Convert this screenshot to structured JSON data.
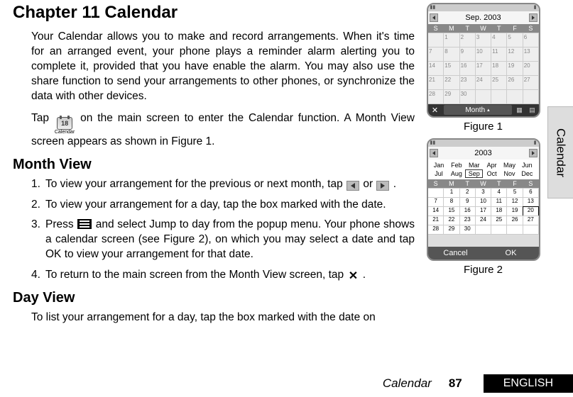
{
  "chapter_title": "Chapter 11 Calendar",
  "intro_p1": "Your Calendar allows you to make and record arrangements. When it's time for an arranged event, your phone plays a reminder alarm alerting you to complete it, provided that you have enable the alarm. You may also use the share function to send your arrangements to other phones, or synchronize the data with other devices.",
  "intro_p2_a": "Tap",
  "intro_p2_b": "on the main screen to enter the Calendar function. A Month View screen appears as shown in Figure 1.",
  "cal_icon_label": "Calendar",
  "cal_icon_num": "18",
  "section_month": "Month View",
  "month_items": {
    "i1_a": "To view your arrangement for the previous or next month, tap",
    "i1_b": "or",
    "i1_c": ".",
    "i2": "To view your arrangement for a day, tap the box marked with the date.",
    "i3_a": "Press",
    "i3_b": "and select Jump to day from the popup menu. Your phone shows a calendar screen (see Figure 2), on which you may select a date and tap OK to view your arrangement for that date.",
    "i4_a": "To return to the main screen from the Month View screen, tap",
    "i4_b": "."
  },
  "section_day": "Day View",
  "day_p1": "To list your arrangement for a day, tap the box marked with the date on",
  "tab_label": "Calendar",
  "figure1": {
    "label": "Figure 1",
    "title": "Sep. 2003",
    "weekdays": [
      "S",
      "M",
      "T",
      "W",
      "T",
      "F",
      "S"
    ],
    "rows": [
      [
        "",
        "1",
        "2",
        "3",
        "4",
        "5",
        "6"
      ],
      [
        "7",
        "8",
        "9",
        "10",
        "11",
        "12",
        "13"
      ],
      [
        "14",
        "15",
        "16",
        "17",
        "18",
        "19",
        "20"
      ],
      [
        "21",
        "22",
        "23",
        "24",
        "25",
        "26",
        "27"
      ],
      [
        "28",
        "29",
        "30",
        "",
        "",
        "",
        ""
      ]
    ],
    "foot_close": "✕",
    "foot_mid": "Month"
  },
  "figure2": {
    "label": "Figure 2",
    "year": "2003",
    "months": [
      "Jan",
      "Feb",
      "Mar",
      "Apr",
      "May",
      "Jun",
      "Jul",
      "Aug",
      "Sep",
      "Oct",
      "Nov",
      "Dec"
    ],
    "selected_month": "Sep",
    "weekdays": [
      "S",
      "M",
      "T",
      "W",
      "T",
      "F",
      "S"
    ],
    "rows": [
      [
        "",
        "1",
        "2",
        "3",
        "4",
        "5",
        "6"
      ],
      [
        "7",
        "8",
        "9",
        "10",
        "11",
        "12",
        "13"
      ],
      [
        "14",
        "15",
        "16",
        "17",
        "18",
        "19",
        "20"
      ],
      [
        "21",
        "22",
        "23",
        "24",
        "25",
        "26",
        "27"
      ],
      [
        "28",
        "29",
        "30",
        "",
        "",
        "",
        ""
      ]
    ],
    "highlight": "20",
    "btn_cancel": "Cancel",
    "btn_ok": "OK"
  },
  "footer": {
    "section": "Calendar",
    "page": "87",
    "lang": "ENGLISH"
  }
}
